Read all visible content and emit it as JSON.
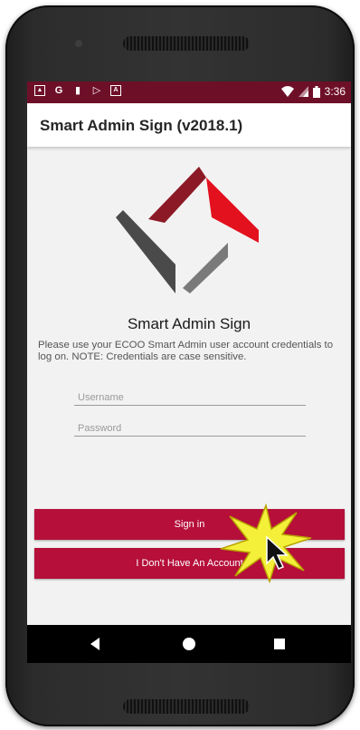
{
  "status_bar": {
    "left_icons": [
      "gallery-icon",
      "google-icon",
      "clipboard-icon",
      "play-store-icon",
      "a-icon"
    ],
    "time": "3:36"
  },
  "app_bar": {
    "title": "Smart Admin Sign (v2018.1)"
  },
  "login": {
    "brand_name": "Smart Admin Sign",
    "notice": "Please use your ECOO Smart Admin user account credentials to log on. NOTE: Credentials are case sensitive.",
    "username_placeholder": "Username",
    "username_value": "",
    "password_placeholder": "Password",
    "password_value": "",
    "signin_label": "Sign in",
    "no_account_label": "I Don't Have An Account"
  },
  "colors": {
    "status_bar": "#6e0f28",
    "primary_button": "#b50f3a",
    "logo_dark_red": "#8c1a26",
    "logo_red": "#e3101e",
    "logo_dark_gray": "#4a4a4a",
    "logo_gray": "#7a7a7a"
  }
}
